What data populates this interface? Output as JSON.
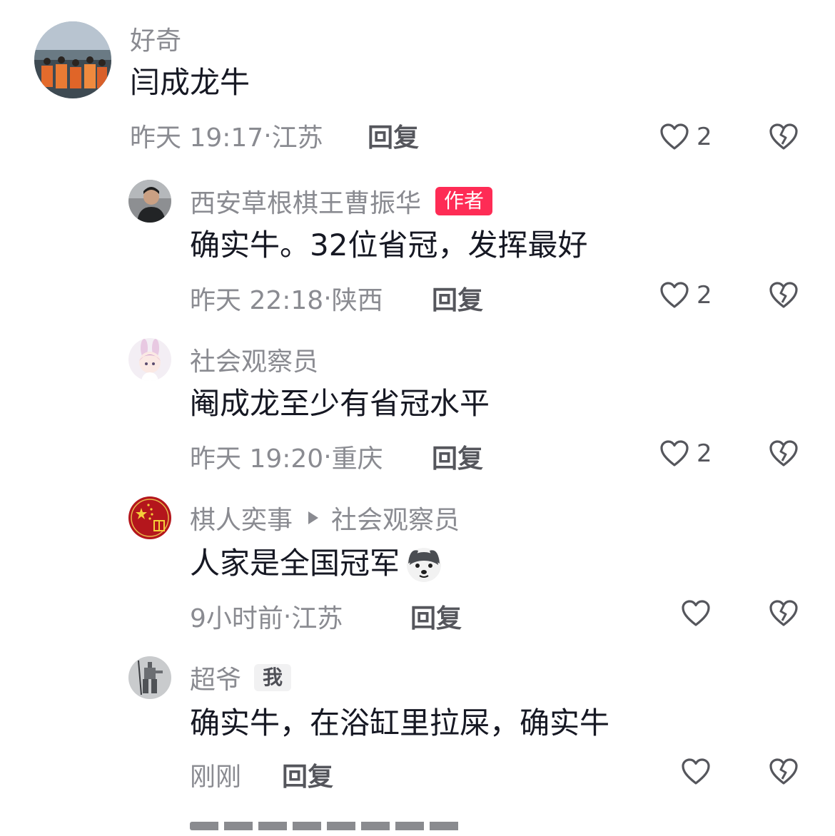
{
  "comments": [
    {
      "username": "好奇",
      "text": "闫成龙牛",
      "time": "昨天 19:17",
      "location": "江苏",
      "reply_label": "回复",
      "likes": "2"
    },
    {
      "username": "西安草根棋王曹振华",
      "badge": "作者",
      "text": "确实牛。32位省冠，发挥最好",
      "time": "昨天 22:18",
      "location": "陕西",
      "reply_label": "回复",
      "likes": "2"
    },
    {
      "username": "社会观察员",
      "text": "阉成龙至少有省冠水平",
      "time": "昨天 19:20",
      "location": "重庆",
      "reply_label": "回复",
      "likes": "2"
    },
    {
      "username": "棋人奕事",
      "reply_to": "社会观察员",
      "text": "人家是全国冠军",
      "emoji": "doge-emoji",
      "time": "9小时前",
      "location": "江苏",
      "reply_label": "回复",
      "likes": ""
    },
    {
      "username": "超爷",
      "badge": "我",
      "text": "确实牛，在浴缸里拉屎，确实牛",
      "time": "刚刚",
      "location": "",
      "reply_label": "回复",
      "likes": ""
    }
  ],
  "colors": {
    "author_badge": "#fe2c55",
    "secondary_text": "#8a8b91",
    "primary_text": "#161823"
  },
  "icons": {
    "like": "heart-outline-icon",
    "dislike": "broken-heart-icon"
  }
}
